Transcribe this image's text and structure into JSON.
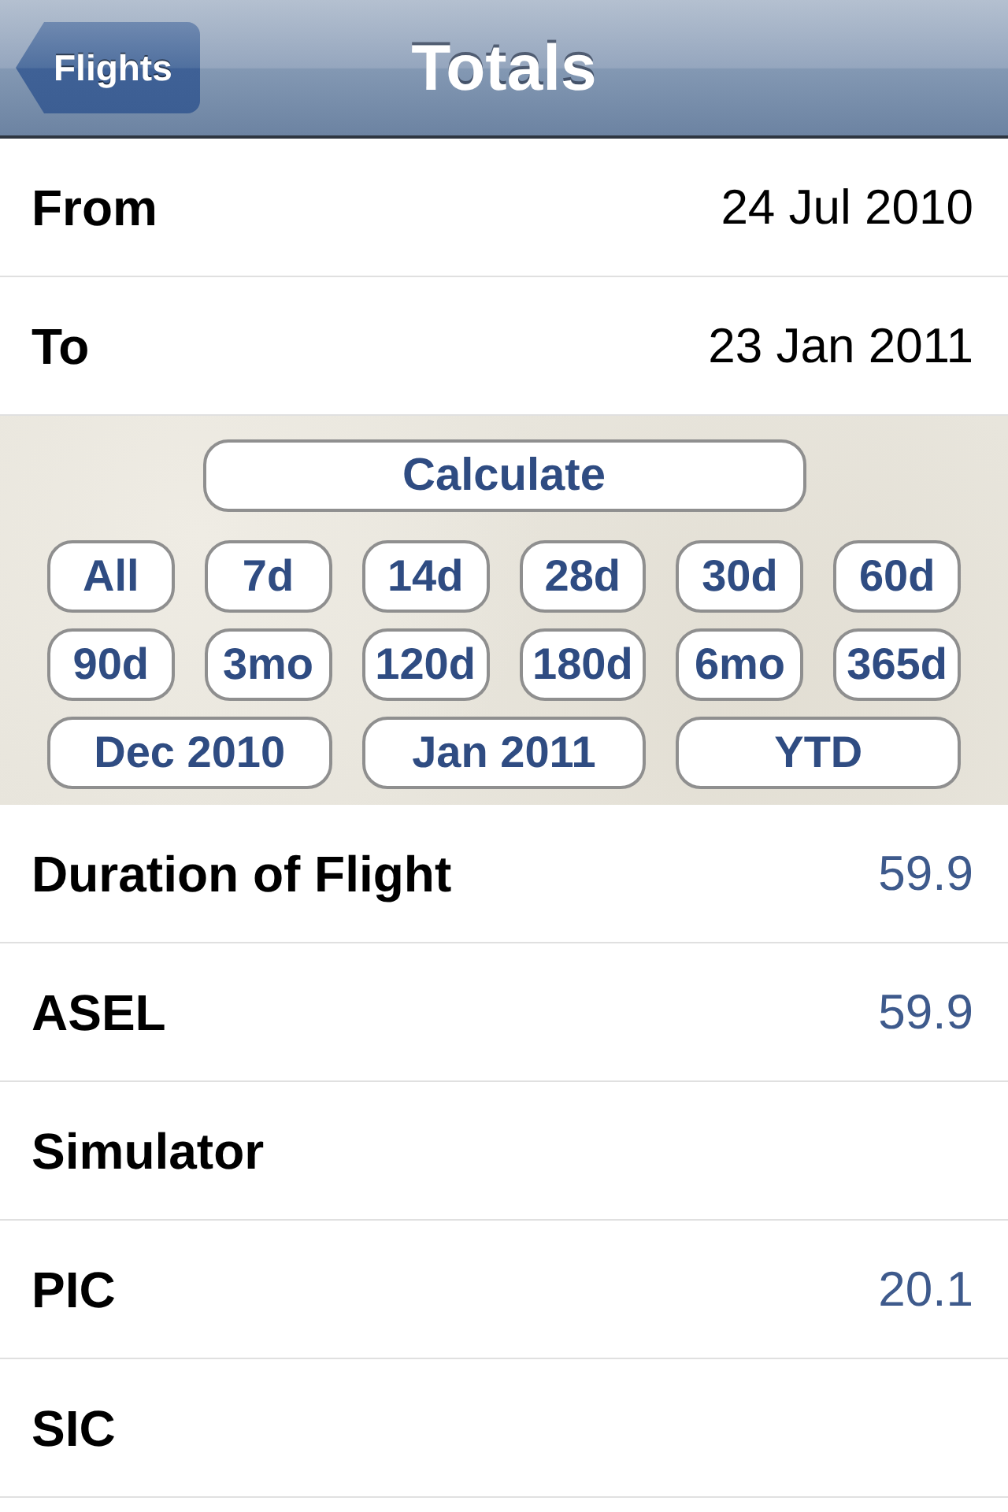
{
  "nav_bar": {
    "back_button": "Flights",
    "title": "Totals"
  },
  "date_range": [
    {
      "label": "From",
      "value": "24 Jul 2010"
    },
    {
      "label": "To",
      "value": "23 Jan 2011"
    }
  ],
  "calculate_button": "Calculate",
  "period_buttons": [
    {
      "label": "All",
      "kind": "short"
    },
    {
      "label": "7d",
      "kind": "short"
    },
    {
      "label": "14d",
      "kind": "short"
    },
    {
      "label": "28d",
      "kind": "short"
    },
    {
      "label": "30d",
      "kind": "short"
    },
    {
      "label": "60d",
      "kind": "short"
    },
    {
      "label": "90d",
      "kind": "short"
    },
    {
      "label": "3mo",
      "kind": "short"
    },
    {
      "label": "120d",
      "kind": "short"
    },
    {
      "label": "180d",
      "kind": "short"
    },
    {
      "label": "6mo",
      "kind": "short"
    },
    {
      "label": "365d",
      "kind": "short"
    },
    {
      "label": "Dec 2010",
      "kind": "wide"
    },
    {
      "label": "Jan 2011",
      "kind": "wide"
    },
    {
      "label": "YTD",
      "kind": "wide"
    }
  ],
  "totals": [
    {
      "label": "Duration of Flight",
      "value": "59.9"
    },
    {
      "label": "ASEL",
      "value": "59.9"
    },
    {
      "label": "Simulator"
    },
    {
      "label": "PIC",
      "value": "20.1"
    },
    {
      "label": "SIC"
    }
  ]
}
